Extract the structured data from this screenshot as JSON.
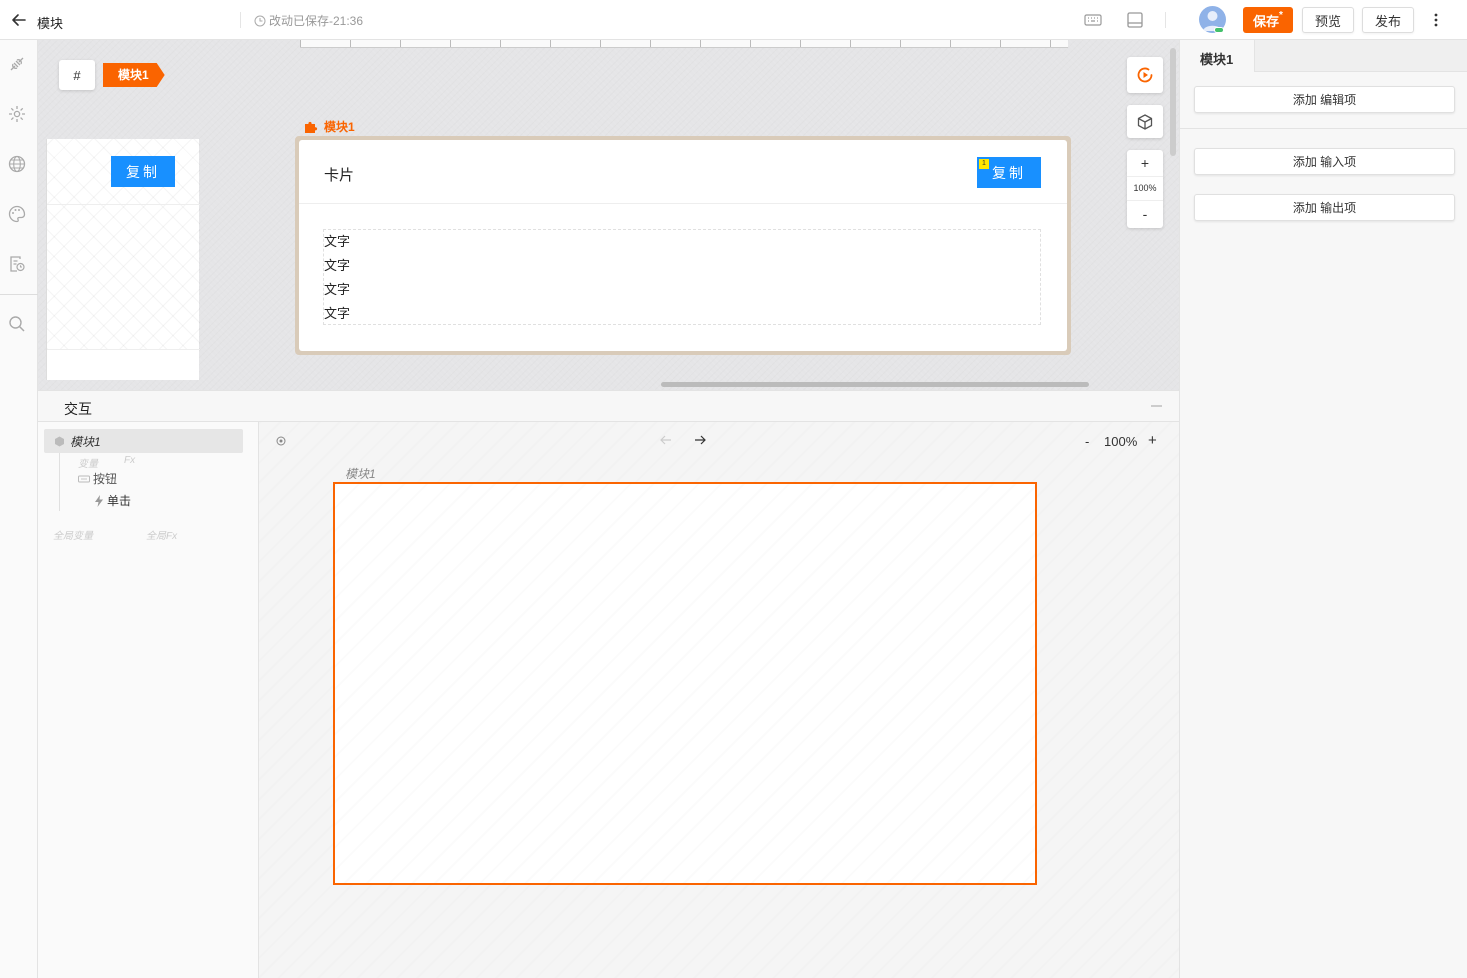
{
  "header": {
    "title": "模块",
    "save_status": "改动已保存-21:36",
    "save_label": "保存",
    "save_dirty_mark": "*",
    "preview_label": "预览",
    "publish_label": "发布"
  },
  "canvas": {
    "hash_label": "#",
    "breadcrumb": "模块1",
    "module_label": "模块1",
    "side_button_label": "复制",
    "card": {
      "title": "卡片",
      "button_label": "复制",
      "button_badge": "1",
      "texts": [
        "文字",
        "文字",
        "文字",
        "文字"
      ]
    },
    "zoom_in": "+",
    "zoom_level": "100%",
    "zoom_out": "-"
  },
  "interaction": {
    "title": "交互",
    "tree": {
      "module": "模块1",
      "variable_label": "变量",
      "fx_label": "Fx",
      "button_item": "按钮",
      "click_item": "单击",
      "global_variable_label": "全局变量",
      "global_fx_label": "全局Fx"
    },
    "flow": {
      "zoom_out": "-",
      "zoom_level": "100%",
      "zoom_in": "+",
      "frame_label": "模块1"
    }
  },
  "right_panel": {
    "tab_label": "模块1",
    "add_edit_label": "添加 编辑项",
    "add_input_label": "添加 输入项",
    "add_output_label": "添加 输出项"
  },
  "colors": {
    "brand": "#fa6400",
    "primary_button": "#1890ff"
  }
}
